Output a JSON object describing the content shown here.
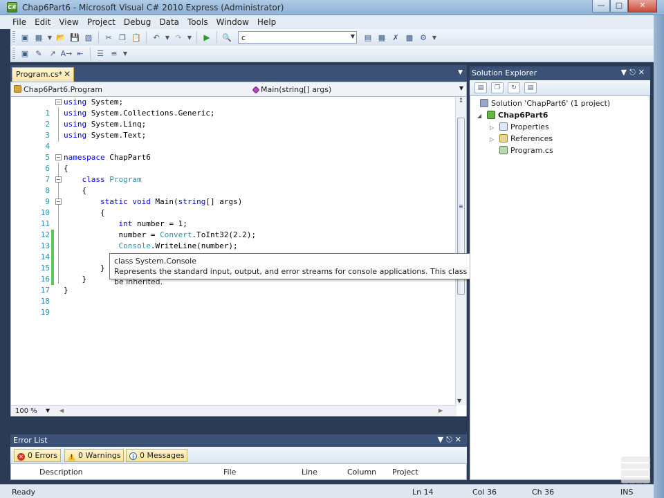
{
  "window": {
    "title": "Chap6Part6 - Microsoft Visual C# 2010 Express (Administrator)",
    "icon": "visual-csharp-icon",
    "controls": [
      "minimize",
      "maximize",
      "close"
    ]
  },
  "menu": {
    "items": [
      "File",
      "Edit",
      "View",
      "Project",
      "Debug",
      "Data",
      "Tools",
      "Window",
      "Help"
    ]
  },
  "toolbar": {
    "find_combo_value": "c"
  },
  "editor": {
    "tab_label": "Program.cs*",
    "nav_type": "Chap6Part6.Program",
    "nav_member": "Main(string[] args)",
    "zoom": "100 %",
    "line_numbers": [
      "1",
      "2",
      "3",
      "4",
      "5",
      "6",
      "7",
      "8",
      "9",
      "10",
      "11",
      "12",
      "13",
      "14",
      "15",
      "16",
      "17",
      "18",
      "19"
    ],
    "lines": {
      "l1": {
        "k": "using",
        "t": " System;"
      },
      "l2": {
        "k": "using",
        "t": " System.Collections.Generic;"
      },
      "l3": {
        "k": "using",
        "t": " System.Linq;"
      },
      "l4": {
        "k": "using",
        "t": " System.Text;"
      },
      "l6": {
        "k": "namespace",
        "t": " ChapPart6"
      },
      "l7": {
        "t": "{"
      },
      "l8": {
        "k": "class",
        "ty": "Program"
      },
      "l9": {
        "t": "{"
      },
      "l10": {
        "k": "static",
        "k2": "void",
        "t": " Main(",
        "k3": "string",
        "t2": "[] args)"
      },
      "l11": {
        "t": "{"
      },
      "l12": {
        "k": "int",
        "t": " number = 1;"
      },
      "l13": {
        "t": "number = ",
        "ty": "Convert",
        "t2": ".ToInt32(2.2);"
      },
      "l14": {
        "ty": "Console",
        "t": ".WriteLine(number);"
      },
      "l16": {
        "t": "}"
      },
      "l17": {
        "t": "}"
      },
      "l18": {
        "t": "}"
      }
    },
    "tooltip": {
      "title": "class System.Console",
      "description": "Represents the standard input, output, and error streams for console applications. This class cannot be inherited."
    }
  },
  "solution_explorer": {
    "title": "Solution Explorer",
    "solution": "Solution 'ChapPart6' (1 project)",
    "project": "Chap6Part6",
    "items": [
      "Properties",
      "References",
      "Program.cs"
    ]
  },
  "error_list": {
    "title": "Error List",
    "errors": "0 Errors",
    "warnings": "0 Warnings",
    "messages": "0 Messages",
    "columns": [
      "Description",
      "File",
      "Line",
      "Column",
      "Project"
    ]
  },
  "status": {
    "ready": "Ready",
    "ln": "Ln 14",
    "col": "Col 36",
    "ch": "Ch 36",
    "ins": "INS"
  }
}
